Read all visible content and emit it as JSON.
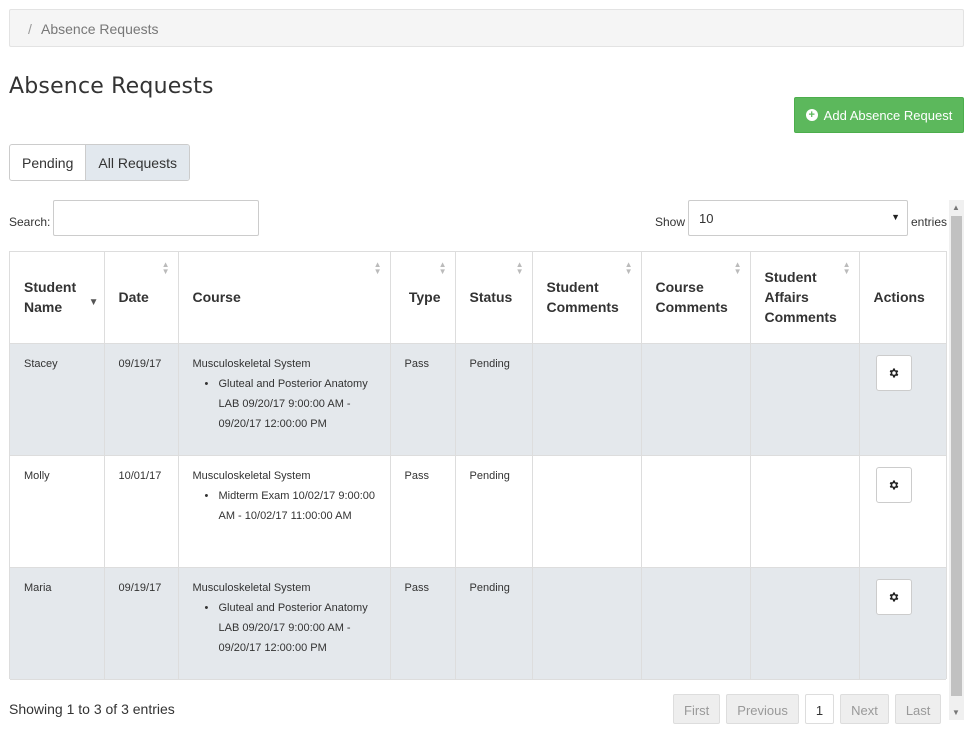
{
  "breadcrumb": {
    "sep": "/",
    "current": "Absence Requests"
  },
  "page": {
    "title": "Absence Requests"
  },
  "add_button": {
    "label": "Add Absence Request"
  },
  "tabs": [
    {
      "label": "Pending"
    },
    {
      "label": "All Requests"
    }
  ],
  "search": {
    "label": "Search:",
    "value": ""
  },
  "length": {
    "show_label": "Show",
    "value": "10",
    "entries_label": "entries"
  },
  "table": {
    "columns": [
      {
        "label": "Student Name"
      },
      {
        "label": "Date"
      },
      {
        "label": "Course"
      },
      {
        "label": "Type"
      },
      {
        "label": "Status"
      },
      {
        "label": "Student Comments"
      },
      {
        "label": "Course Comments"
      },
      {
        "label": "Student Affairs Comments"
      },
      {
        "label": "Actions"
      }
    ],
    "rows": [
      {
        "student": "Stacey",
        "date": "09/19/17",
        "course": "Musculoskeletal System",
        "session": "Gluteal and Posterior Anatomy LAB 09/20/17 9:00:00 AM - 09/20/17 12:00:00 PM",
        "type": "Pass",
        "status": "Pending",
        "student_comments": "",
        "course_comments": "",
        "affairs_comments": ""
      },
      {
        "student": "Molly",
        "date": "10/01/17",
        "course": "Musculoskeletal System",
        "session": "Midterm Exam 10/02/17 9:00:00 AM - 10/02/17 11:00:00 AM",
        "type": "Pass",
        "status": "Pending",
        "student_comments": "",
        "course_comments": "",
        "affairs_comments": ""
      },
      {
        "student": "Maria",
        "date": "09/19/17",
        "course": "Musculoskeletal System",
        "session": "Gluteal and Posterior Anatomy LAB 09/20/17 9:00:00 AM - 09/20/17 12:00:00 PM",
        "type": "Pass",
        "status": "Pending",
        "student_comments": "",
        "course_comments": "",
        "affairs_comments": ""
      }
    ]
  },
  "footer": {
    "info": "Showing 1 to 3 of 3 entries",
    "pager": {
      "first": "First",
      "previous": "Previous",
      "current": "1",
      "next": "Next",
      "last": "Last"
    }
  },
  "colors": {
    "accent": "#5cb85c",
    "row_shade": "#e4e8ec",
    "tab_active": "#e2e8ee"
  },
  "icons": {
    "add": "plus-circle-icon",
    "action": "gear-icon",
    "sort": "sort-icon"
  }
}
